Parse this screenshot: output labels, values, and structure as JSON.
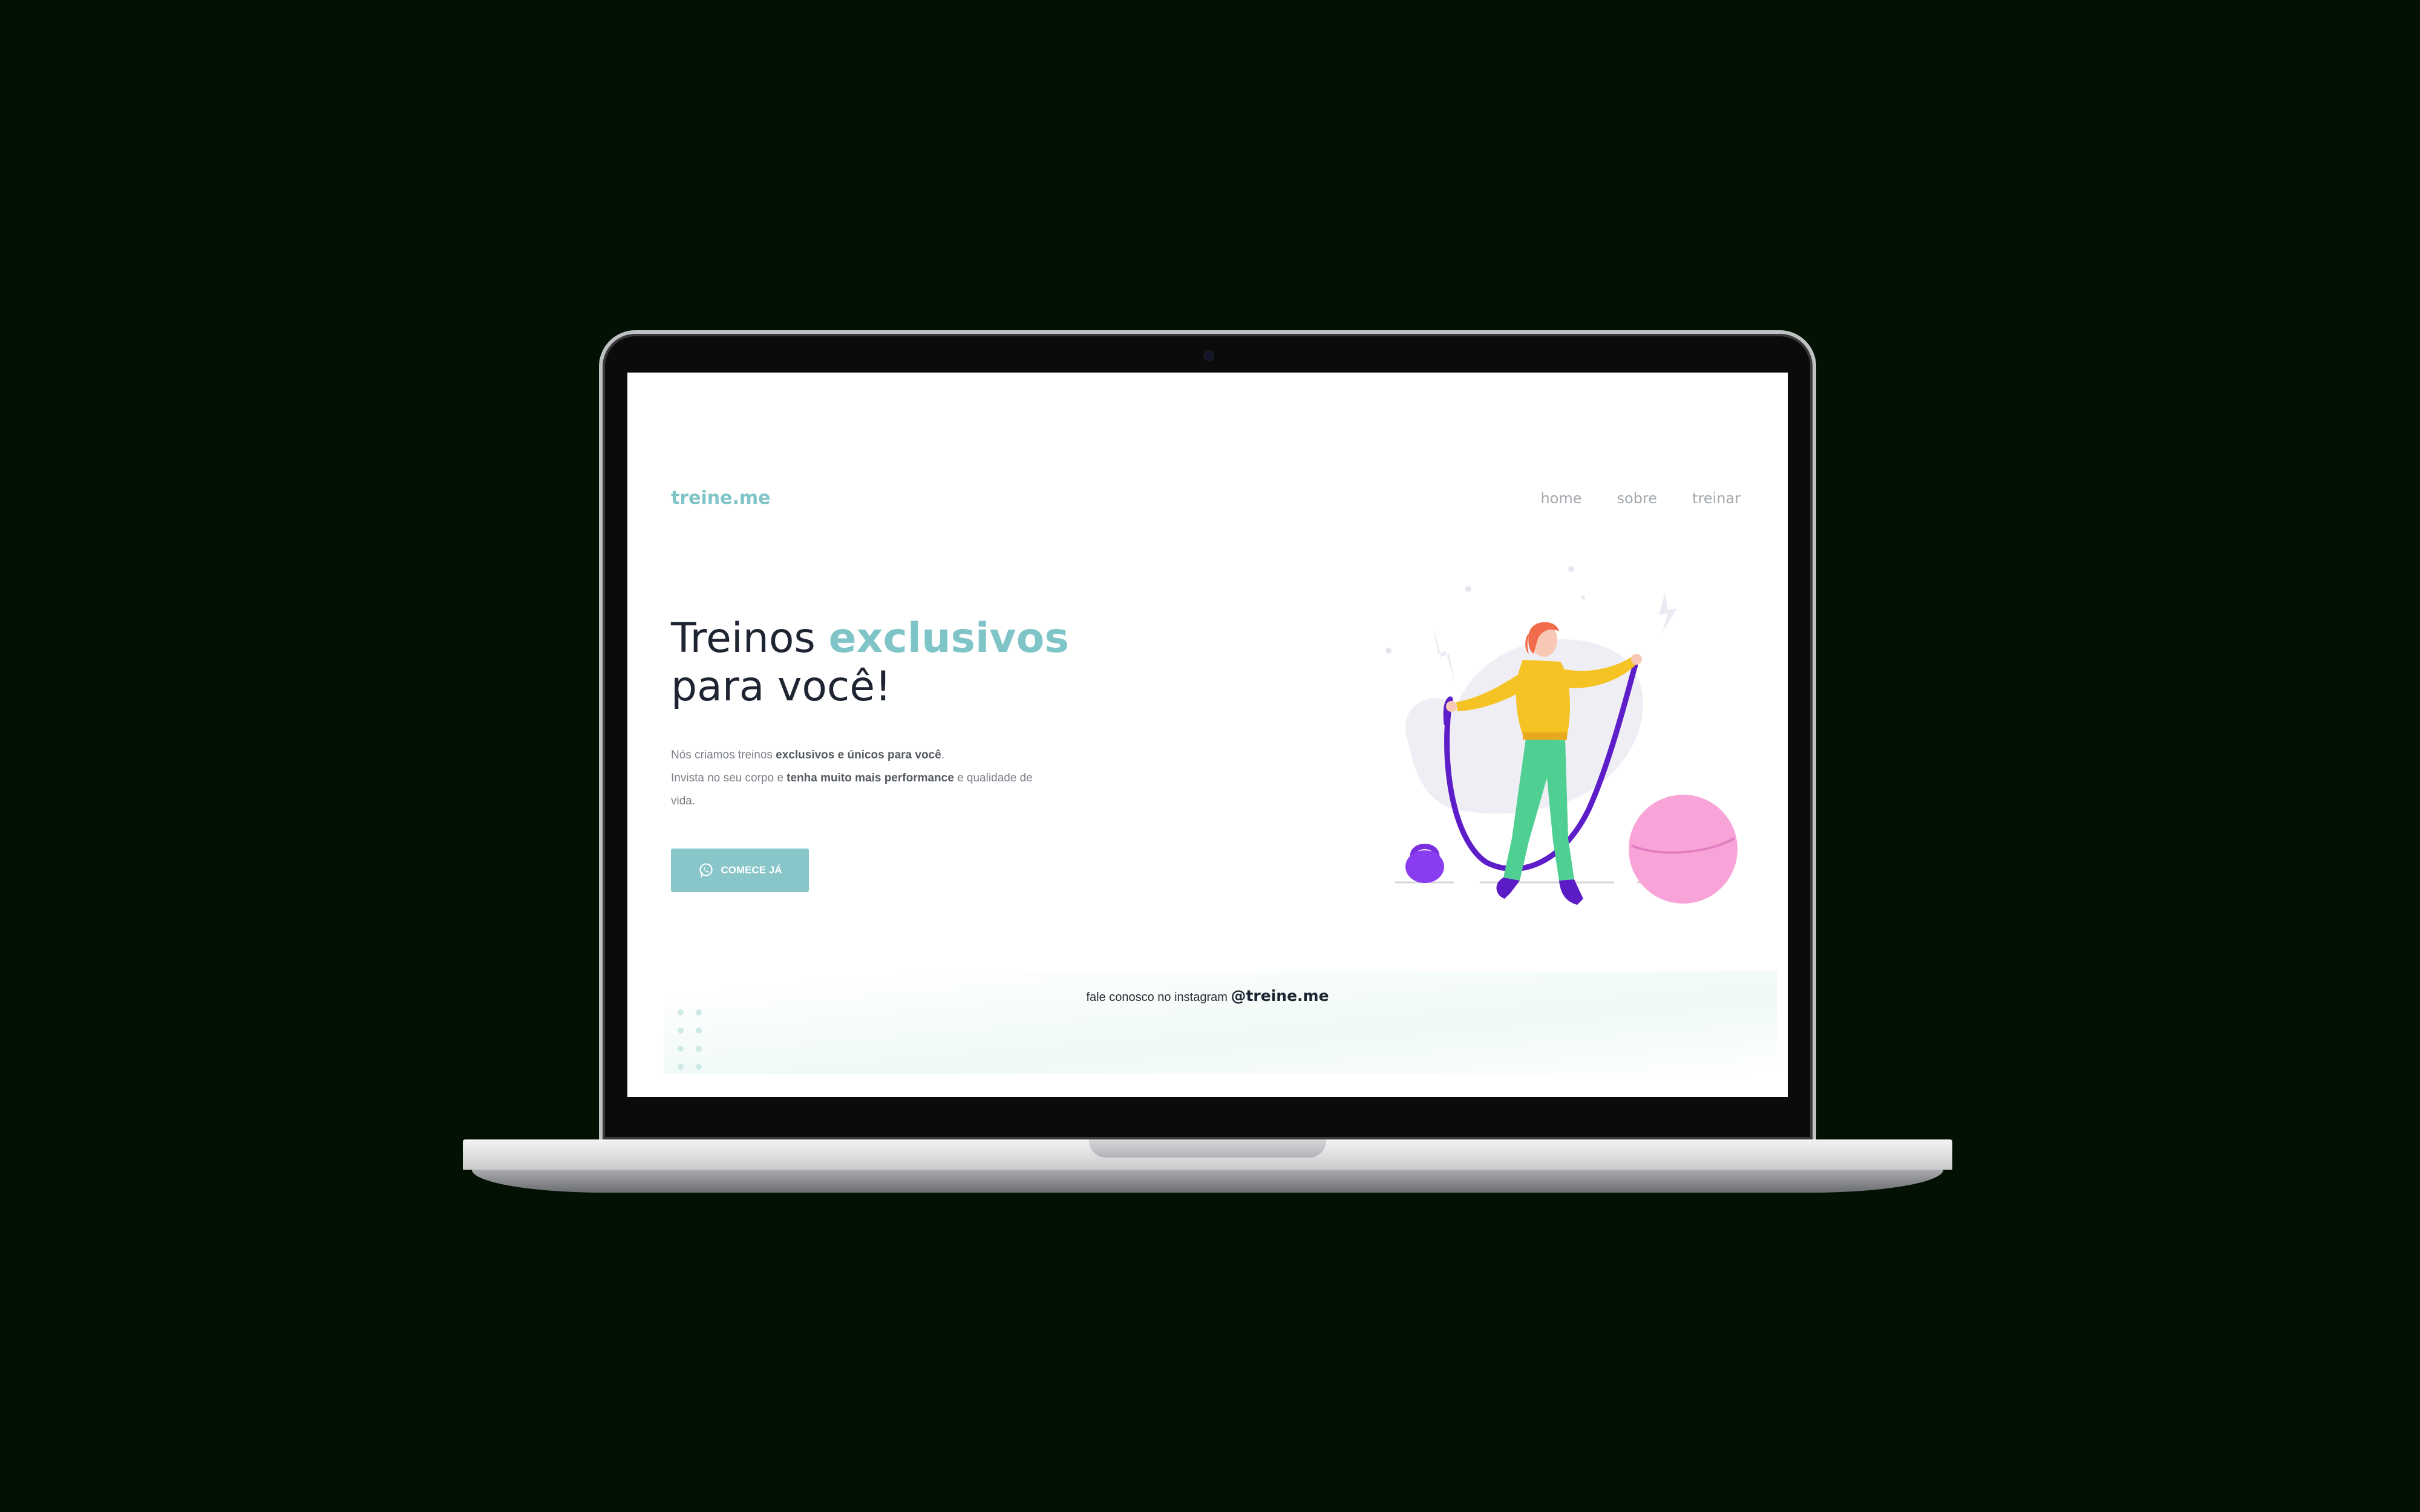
{
  "site": {
    "logo": "treine.me",
    "nav": [
      {
        "label": "home"
      },
      {
        "label": "sobre"
      },
      {
        "label": "treinar"
      }
    ]
  },
  "hero": {
    "title_plain": "Treinos ",
    "title_accent": "exclusivos",
    "title_line2": "para você!",
    "desc_1": "Nós criamos treinos ",
    "desc_1_bold": "exclusivos e únicos para você",
    "desc_1_end": ".",
    "desc_2": "Invista no seu corpo e ",
    "desc_2_bold": "tenha muito mais performance",
    "desc_2_end": " e qualidade de vida.",
    "cta_label": "COMECE JÁ",
    "cta_icon": "whatsapp-icon"
  },
  "footer": {
    "text": "fale conosco no instagram ",
    "handle": "@treine.me"
  },
  "colors": {
    "accent": "#7fc5c8",
    "button": "#89c6ca",
    "dark_text": "#1f2432",
    "background": "#031102"
  }
}
